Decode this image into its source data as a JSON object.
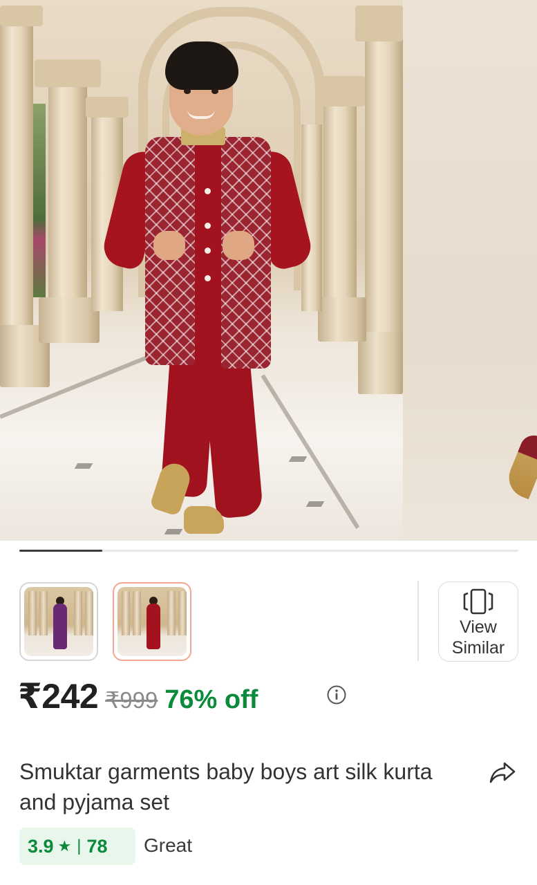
{
  "carousel": {
    "current_index": 1,
    "total_images": 6,
    "progress_fraction": 0.166
  },
  "thumbnails": [
    {
      "label": "purple variant",
      "outfit_color": "#6a2a73",
      "selected": false
    },
    {
      "label": "maroon variant",
      "outfit_color": "#a3121f",
      "selected": true
    }
  ],
  "view_similar": {
    "label": "View Similar",
    "icon": "view-similar-icon"
  },
  "price": {
    "current": "₹242",
    "original": "₹999",
    "discount": "76% off",
    "info_icon": "info-icon"
  },
  "product": {
    "title": "Smuktar garments baby boys art silk kurta and pyjama set",
    "share_icon": "share-icon"
  },
  "rating": {
    "score": "3.9",
    "star": "★",
    "separator": "|",
    "count": "78",
    "label": "Great"
  },
  "colors": {
    "discount_green": "#0a8a3a",
    "rating_bg": "#e8f6ec",
    "selected_thumb_border": "#f6a58f"
  }
}
